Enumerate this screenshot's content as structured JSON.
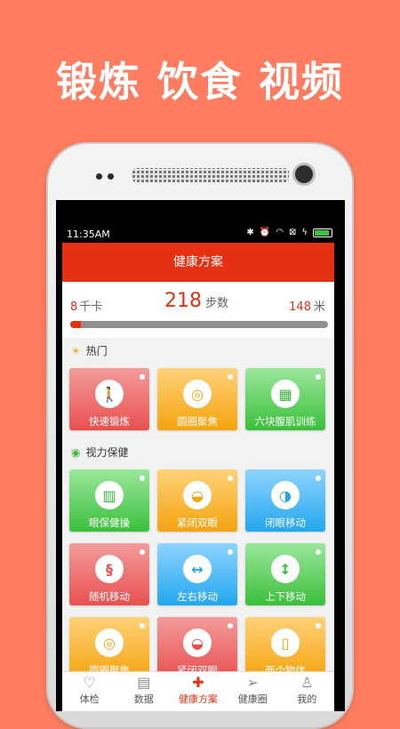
{
  "headline": "锻炼 饮食 视频",
  "status": {
    "time": "11:35AM"
  },
  "app": {
    "title": "健康方案",
    "stats": {
      "calories_value": "8",
      "calories_unit": "千卡",
      "steps_value": "218",
      "steps_unit": "步数",
      "distance_value": "148",
      "distance_unit": "米",
      "progress_fraction": 0.04
    },
    "sections": [
      {
        "title": "热门",
        "icon": "sun-icon"
      },
      {
        "title": "视力保健",
        "icon": "eye-icon"
      }
    ],
    "hot_items": [
      {
        "label": "快速锻炼",
        "color": "#e8504f",
        "icon": "walking-person-icon"
      },
      {
        "label": "圆圈聚焦",
        "color": "#f5a30d",
        "icon": "concentric-circle-icon"
      },
      {
        "label": "六块腹肌训练",
        "color": "#3bbf3b",
        "icon": "abs-icon"
      }
    ],
    "vision_items": [
      {
        "label": "眼保健操",
        "color": "#3bbf3b",
        "icon": "bar-chart-icon"
      },
      {
        "label": "紧闭双眼",
        "color": "#f5a30d",
        "icon": "closed-eye-icon"
      },
      {
        "label": "闭眼移动",
        "color": "#22a6ee",
        "icon": "eye-move-icon"
      },
      {
        "label": "随机移动",
        "color": "#e8504f",
        "icon": "random-move-icon"
      },
      {
        "label": "左右移动",
        "color": "#22a6ee",
        "icon": "left-right-arrow-icon"
      },
      {
        "label": "上下移动",
        "color": "#3bbf3b",
        "icon": "up-down-arrow-icon"
      },
      {
        "label": "圆圈聚焦",
        "color": "#f5a30d",
        "icon": "concentric-circle-icon"
      },
      {
        "label": "紧闭双眼",
        "color": "#e8504f",
        "icon": "closed-eye-icon"
      },
      {
        "label": "两个物体",
        "color": "#f5a30d",
        "icon": "book-icon"
      }
    ],
    "tabs": [
      {
        "label": "体检",
        "icon": "heart-icon",
        "active": false
      },
      {
        "label": "数据",
        "icon": "chart-icon",
        "active": false
      },
      {
        "label": "健康方案",
        "icon": "medical-plus-icon",
        "active": true
      },
      {
        "label": "健康圈",
        "icon": "paper-plane-icon",
        "active": false
      },
      {
        "label": "我的",
        "icon": "person-icon",
        "active": false
      }
    ]
  }
}
